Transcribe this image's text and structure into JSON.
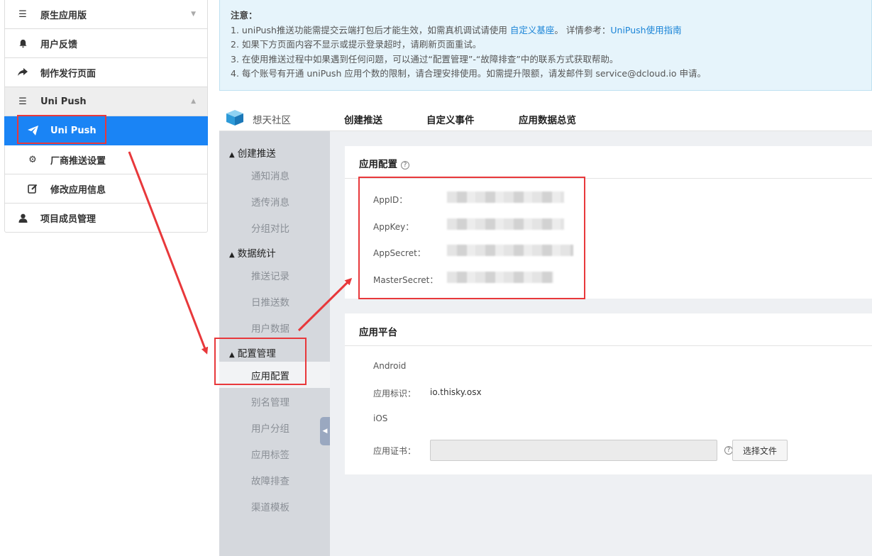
{
  "left_menu": {
    "items": [
      {
        "label": "原生应用版",
        "icon": "list-icon"
      },
      {
        "label": "用户反馈",
        "icon": "bell-icon"
      },
      {
        "label": "制作发行页面",
        "icon": "share-arrow-icon"
      },
      {
        "label": "Uni Push",
        "icon": "list-icon"
      },
      {
        "label": "Uni Push",
        "icon": "paper-plane-icon"
      },
      {
        "label": "厂商推送设置",
        "icon": "gear-icon"
      },
      {
        "label": "修改应用信息",
        "icon": "edit-icon"
      },
      {
        "label": "项目成员管理",
        "icon": "user-icon"
      }
    ]
  },
  "notice": {
    "title": "注意：",
    "line1_prefix": "1. uniPush推送功能需提交云端打包后才能生效，如需真机调试请使用 ",
    "line1_link1": "自定义基座",
    "line1_mid": "。 详情参考：",
    "line1_link2": "UniPush使用指南",
    "line2": "2. 如果下方页面内容不显示或提示登录超时，请刷新页面重试。",
    "line3": "3. 在使用推送过程中如果遇到任何问题，可以通过“配置管理”-“故障排查”中的联系方式获取帮助。",
    "line4": "4. 每个账号有开通 uniPush 应用个数的限制，请合理安排使用。如需提升限额，请发邮件到 service@dcloud.io 申请。"
  },
  "top_bar": {
    "app_name": "想天社区",
    "tabs": [
      "创建推送",
      "自定义事件",
      "应用数据总览"
    ]
  },
  "side_nav": {
    "groups": [
      {
        "label": "创建推送",
        "items": [
          "通知消息",
          "透传消息",
          "分组对比"
        ]
      },
      {
        "label": "数据统计",
        "items": [
          "推送记录",
          "日推送数",
          "用户数据"
        ]
      },
      {
        "label": "配置管理",
        "items": [
          "应用配置",
          "别名管理",
          "用户分组",
          "应用标签",
          "故障排查",
          "渠道模板"
        ]
      }
    ],
    "active_item": "应用配置"
  },
  "app_config": {
    "title": "应用配置",
    "help": "?",
    "fields": [
      {
        "label": "AppID："
      },
      {
        "label": "AppKey："
      },
      {
        "label": "AppSecret："
      },
      {
        "label": "MasterSecret："
      }
    ]
  },
  "app_platform": {
    "title": "应用平台",
    "android_label": "Android",
    "package_label": "应用标识：",
    "package_value": "io.thisky.osx",
    "ios_label": "iOS",
    "cert_label": "应用证书：",
    "help": "?",
    "choose_file": "选择文件"
  },
  "colors": {
    "accent": "#1a84f5",
    "annotation_red": "#e8383b",
    "notice_bg": "#e6f4fb",
    "side_nav_bg": "#d5d8dd"
  }
}
